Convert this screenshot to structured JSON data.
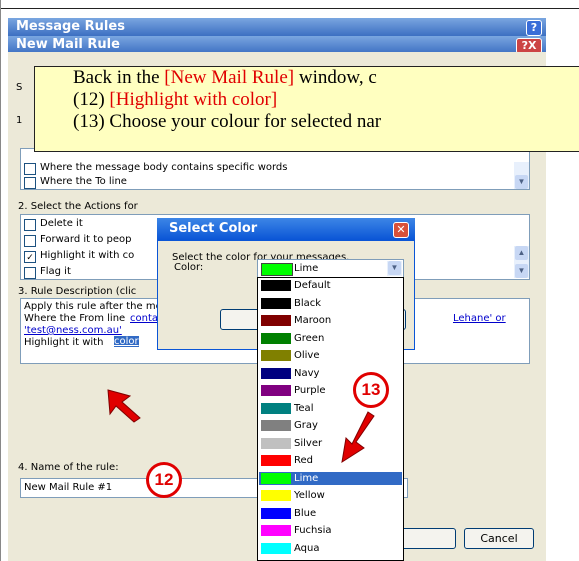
{
  "message_rules_window": {
    "title": "Message Rules",
    "help_symbol": "?"
  },
  "new_mail_rule": {
    "title": "New Mail Rule",
    "close_symbol": "?X",
    "section1_label_prefix": "S",
    "section1_num": "1",
    "conditions": [
      {
        "label": "Where the message body contains specific words",
        "checked": false
      },
      {
        "label": "Where the To line",
        "checked": false
      }
    ],
    "section2_label": "2. Select the Actions for",
    "actions": [
      {
        "label": "Delete it",
        "checked": false
      },
      {
        "label": "Forward it to peop",
        "checked": false
      },
      {
        "label": "Highlight it with co",
        "checked": true
      },
      {
        "label": "Flag it",
        "checked": false
      }
    ],
    "section3_label": "3. Rule Description (clic",
    "description": {
      "line1": "Apply this rule after the message arrives",
      "line2_prefix": "Where the From line",
      "line2_link": "contains 'tommax@",
      "line2_tail_link": "Lehane' or",
      "line3_link": "'test@ness.com.au'",
      "line4_prefix": "Highlight it with",
      "line4_link": "color"
    },
    "section4_label": "4. Name of the rule:",
    "rule_name": "New Mail Rule #1",
    "cancel_label": "Cancel"
  },
  "callout": {
    "line1_prefix": "Back in the ",
    "line1_red": "[New Mail Rule]",
    "line1_suffix": " window,  c",
    "line2_num": "(12) ",
    "line2_red": "[Highlight with color]",
    "line3": "(13) Choose your colour for selected nar"
  },
  "select_color": {
    "title": "Select Color",
    "prompt": "Select the color for your messages.",
    "color_label": "Color:",
    "selected": "Lime",
    "selected_swatch": "#00ff00",
    "options": [
      {
        "name": "Default",
        "hex": "#000000"
      },
      {
        "name": "Black",
        "hex": "#000000"
      },
      {
        "name": "Maroon",
        "hex": "#800000"
      },
      {
        "name": "Green",
        "hex": "#008000"
      },
      {
        "name": "Olive",
        "hex": "#808000"
      },
      {
        "name": "Navy",
        "hex": "#000080"
      },
      {
        "name": "Purple",
        "hex": "#800080"
      },
      {
        "name": "Teal",
        "hex": "#008080"
      },
      {
        "name": "Gray",
        "hex": "#808080"
      },
      {
        "name": "Silver",
        "hex": "#c0c0c0"
      },
      {
        "name": "Red",
        "hex": "#ff0000"
      },
      {
        "name": "Lime",
        "hex": "#00ff00",
        "selected": true
      },
      {
        "name": "Yellow",
        "hex": "#ffff00"
      },
      {
        "name": "Blue",
        "hex": "#0000ff"
      },
      {
        "name": "Fuchsia",
        "hex": "#ff00ff"
      },
      {
        "name": "Aqua",
        "hex": "#00ffff"
      }
    ]
  },
  "annotations": {
    "step12": "12",
    "step13": "13"
  }
}
